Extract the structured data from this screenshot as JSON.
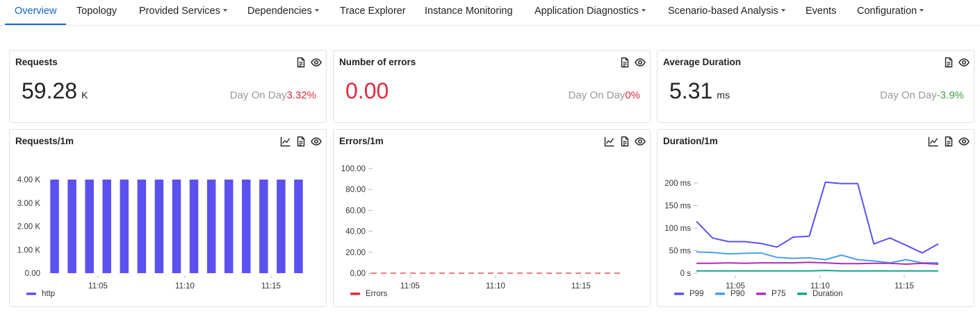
{
  "tabs": [
    {
      "label": "Overview",
      "active": true,
      "caret": false
    },
    {
      "label": "Topology",
      "active": false,
      "caret": false
    },
    {
      "label": "Provided Services",
      "active": false,
      "caret": true
    },
    {
      "label": "Dependencies",
      "active": false,
      "caret": true
    },
    {
      "label": "Trace Explorer",
      "active": false,
      "caret": false
    },
    {
      "label": "Instance Monitoring",
      "active": false,
      "caret": false
    },
    {
      "label": "Application Diagnostics",
      "active": false,
      "caret": true
    },
    {
      "label": "Scenario-based Analysis",
      "active": false,
      "caret": true
    },
    {
      "label": "Events",
      "active": false,
      "caret": false
    },
    {
      "label": "Configuration",
      "active": false,
      "caret": true
    }
  ],
  "stats": [
    {
      "title": "Requests",
      "value": "59.28",
      "unit": "K",
      "dod_label": "Day On Day",
      "dod_value": "3.32%",
      "dod_trend": "pos",
      "value_color": "normal"
    },
    {
      "title": "Number of errors",
      "value": "0.00",
      "unit": "",
      "dod_label": "Day On Day",
      "dod_value": "0%",
      "dod_trend": "pos",
      "value_color": "red"
    },
    {
      "title": "Average Duration",
      "value": "5.31",
      "unit": "ms",
      "dod_label": "Day On Day",
      "dod_value": "-3.9%",
      "dod_trend": "neg",
      "value_color": "normal"
    }
  ],
  "icons": {
    "doc": "document-icon",
    "eye": "eye-icon",
    "chart": "line-chart-icon"
  },
  "colors": {
    "accent": "#1565c0",
    "bar": "#5b51f0",
    "errors": "#e0293b",
    "p99": "#5b51f0",
    "p90": "#4a9ef0",
    "p75": "#b02cb5",
    "duration": "#14a38b"
  },
  "chart_data": [
    {
      "type": "bar",
      "title": "Requests/1m",
      "x_ticks": [
        "11:05",
        "11:10",
        "11:15"
      ],
      "y_ticks": [
        "0.00",
        "1.00 K",
        "2.00 K",
        "3.00 K",
        "4.00 K"
      ],
      "ylim": [
        0,
        4000
      ],
      "series": [
        {
          "name": "http",
          "values": [
            4000,
            4000,
            4000,
            4000,
            4000,
            4000,
            4000,
            4000,
            4000,
            4000,
            4000,
            4000,
            4000,
            4000,
            4000
          ]
        }
      ],
      "legend": "bottom-left"
    },
    {
      "type": "line",
      "title": "Errors/1m",
      "x_ticks": [
        "11:05",
        "11:10",
        "11:15"
      ],
      "y_ticks": [
        "0.00",
        "20.00",
        "40.00",
        "60.00",
        "80.00",
        "100.00"
      ],
      "ylim": [
        0,
        100
      ],
      "series": [
        {
          "name": "Errors",
          "values": [
            0,
            0,
            0,
            0,
            0,
            0,
            0,
            0,
            0,
            0,
            0,
            0,
            0,
            0,
            0
          ]
        }
      ],
      "legend": "bottom-left"
    },
    {
      "type": "line",
      "title": "Duration/1m",
      "x_ticks": [
        "11:05",
        "11:10",
        "11:15"
      ],
      "y_ticks": [
        "0 s",
        "50 ms",
        "100 ms",
        "150 ms",
        "200 ms"
      ],
      "ylim": [
        0,
        200
      ],
      "series": [
        {
          "name": "P99",
          "values": [
            115,
            78,
            70,
            70,
            66,
            58,
            80,
            82,
            202,
            199,
            199,
            65,
            78,
            62,
            45,
            65
          ]
        },
        {
          "name": "P90",
          "values": [
            47,
            46,
            43,
            44,
            45,
            35,
            33,
            34,
            30,
            40,
            30,
            27,
            23,
            30,
            23,
            23
          ]
        },
        {
          "name": "P75",
          "values": [
            22,
            22,
            23,
            22,
            23,
            23,
            23,
            24,
            23,
            21,
            21,
            22,
            22,
            20,
            22,
            20
          ]
        },
        {
          "name": "Duration",
          "values": [
            5,
            5,
            5,
            5,
            5,
            5,
            5,
            5,
            6,
            5,
            5,
            5,
            5,
            5,
            5,
            5
          ]
        }
      ],
      "legend": "bottom-left"
    }
  ]
}
